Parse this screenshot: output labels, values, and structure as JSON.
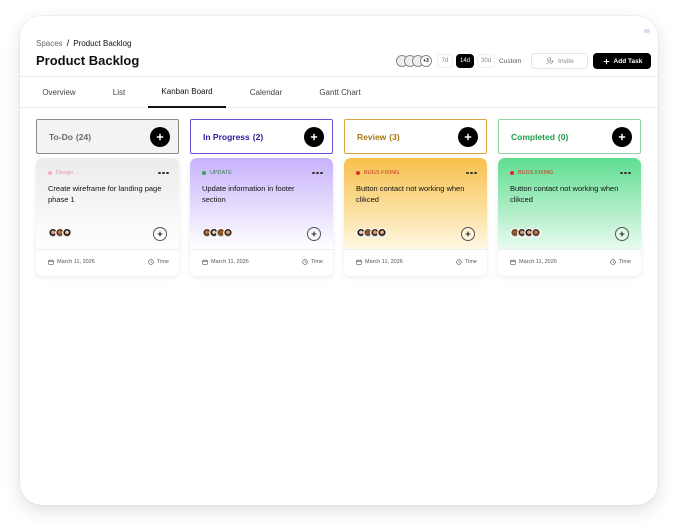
{
  "header": {
    "breadcrumb": {
      "parent": "Spaces",
      "separator": "/",
      "current": "Product Backlog"
    },
    "title": "Product Backlog",
    "avatar_count": "+3",
    "ranges": [
      "7d",
      "14d",
      "30d"
    ],
    "active_range": "14d",
    "custom_label": "Custom",
    "invite_label": "Invite",
    "add_task_label": "Add Task"
  },
  "tabs": [
    {
      "label": "Overview"
    },
    {
      "label": "List"
    },
    {
      "label": "Kanban Board",
      "active": true
    },
    {
      "label": "Calendar"
    },
    {
      "label": "Gantt Chart"
    }
  ],
  "columns": [
    {
      "title": "To-Do",
      "count": "(24)",
      "color": "#6b6b6b",
      "border": "#8a8a8a",
      "background": "#f3f3f3",
      "card": {
        "tag": "Design",
        "tag_color": "#f08fbd",
        "tag_dot": "#f4a9cb",
        "title": "Create wireframe for landing page phase 1",
        "gradient": [
          "#ebebeb",
          "#ffffff"
        ],
        "assignee_count": 3,
        "date": "March 11, 2026",
        "time": "Time"
      }
    },
    {
      "title": "In Progress",
      "count": "(2)",
      "color": "#2e1a9e",
      "border": "#6b4fd6",
      "background": "#ffffff",
      "card": {
        "tag": "UPDATE",
        "tag_color": "#3b7d4a",
        "tag_dot": "#34a853",
        "title": "Update information in footer section",
        "gradient": [
          "#c8b2fb",
          "#ffffff"
        ],
        "assignee_count": 4,
        "date": "March 11, 2026",
        "time": "Time"
      }
    },
    {
      "title": "Review",
      "count": "(3)",
      "color": "#a67a12",
      "border": "#d8a63c",
      "background": "#ffffff",
      "card": {
        "tag": "BUGS FIXING",
        "tag_color": "#c0392b",
        "tag_dot": "#e5262b",
        "title": "Button contact not working when clikced",
        "gradient": [
          "#f7c04a",
          "#fff7e2"
        ],
        "assignee_count": 4,
        "date": "March 11, 2026",
        "time": "Time"
      }
    },
    {
      "title": "Completed",
      "count": "(0)",
      "color": "#1f9b4a",
      "border": "#8fd4a5",
      "background": "#ffffff",
      "card": {
        "tag": "BUGS FIXING",
        "tag_color": "#c0392b",
        "tag_dot": "#e5262b",
        "title": "Button contact not working when clikced",
        "gradient": [
          "#5fdd90",
          "#e9fbef"
        ],
        "assignee_count": 4,
        "date": "March 11, 2026",
        "time": "Time"
      }
    }
  ],
  "icons": {
    "add": "plus-icon",
    "more": "more-horizontal-icon",
    "invite": "user-plus-icon",
    "date": "calendar-icon",
    "time": "clock-icon"
  }
}
